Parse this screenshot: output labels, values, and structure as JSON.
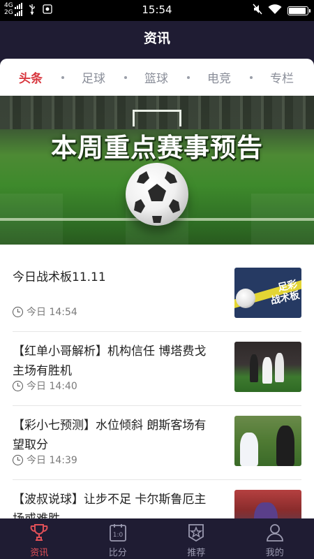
{
  "status_bar": {
    "network_1": "4G",
    "network_2": "2G",
    "time": "15:54",
    "icons": [
      "usb-icon",
      "camera-icon",
      "mute-icon",
      "wifi-icon",
      "battery-icon"
    ],
    "battery_level": 0.95
  },
  "header": {
    "title": "资讯"
  },
  "tabs": [
    {
      "label": "头条",
      "active": true
    },
    {
      "label": "足球",
      "active": false
    },
    {
      "label": "篮球",
      "active": false
    },
    {
      "label": "电竞",
      "active": false
    },
    {
      "label": "专栏",
      "active": false
    }
  ],
  "banner": {
    "title": "本周重点赛事预告"
  },
  "news": [
    {
      "title": "今日战术板11.11",
      "time": "今日 14:54",
      "thumb_text": "足彩\n战术板"
    },
    {
      "title": "【红单小哥解析】机构信任 博塔费戈主场有胜机",
      "time": "今日 14:40"
    },
    {
      "title": "【彩小七预测】水位倾斜 朗斯客场有望取分",
      "time": "今日 14:39"
    },
    {
      "title": "【波叔说球】让步不足 卡尔斯鲁厄主场或难胜",
      "time": ""
    }
  ],
  "tabbar": [
    {
      "label": "资讯",
      "icon": "trophy-icon",
      "active": true
    },
    {
      "label": "比分",
      "icon": "scoreboard-icon",
      "active": false
    },
    {
      "label": "推荐",
      "icon": "star-icon",
      "active": false
    },
    {
      "label": "我的",
      "icon": "person-icon",
      "active": false
    }
  ],
  "colors": {
    "header_bg": "#1f1c33",
    "accent_red": "#d8353d",
    "tab_inactive": "#8a8e99"
  }
}
